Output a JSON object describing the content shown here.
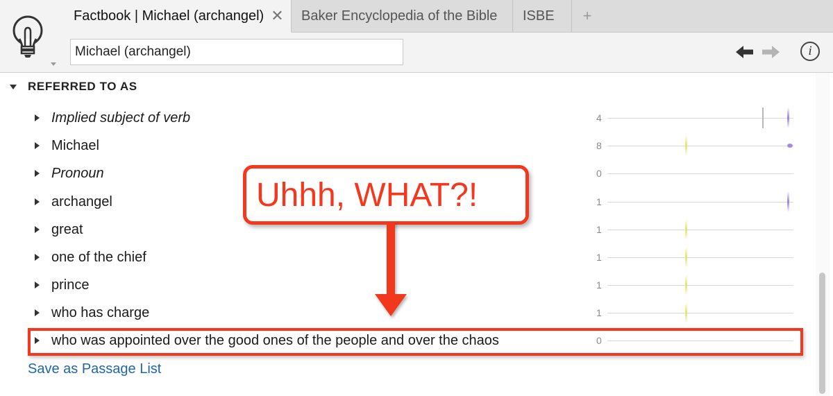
{
  "tabs": [
    {
      "label": "Factbook | Michael (archangel)",
      "active": true,
      "close_glyph": "✕"
    },
    {
      "label": "Baker Encyclopedia of the Bible",
      "active": false
    },
    {
      "label": "ISBE",
      "active": false
    }
  ],
  "add_tab_glyph": "+",
  "search": {
    "value": "Michael (archangel)"
  },
  "icons": {
    "app": "lightbulb-icon",
    "back": "arrow-left-icon",
    "forward": "arrow-right-icon",
    "info": "info-icon",
    "close": "close-icon",
    "add": "plus-icon"
  },
  "info_glyph": "i",
  "section": {
    "title": "REFERRED TO AS"
  },
  "rows": [
    {
      "label": "Implied subject of verb",
      "italic": true,
      "count": "4"
    },
    {
      "label": "Michael",
      "italic": false,
      "count": "8"
    },
    {
      "label": "Pronoun",
      "italic": true,
      "count": "0"
    },
    {
      "label": "archangel",
      "italic": false,
      "count": "1"
    },
    {
      "label": "great",
      "italic": false,
      "count": "1"
    },
    {
      "label": "one of the chief",
      "italic": false,
      "count": "1"
    },
    {
      "label": "prince",
      "italic": false,
      "count": "1"
    },
    {
      "label": "who has charge",
      "italic": false,
      "count": "1"
    },
    {
      "label": "who was appointed over the good ones of the people and over the chaos",
      "italic": false,
      "count": "0"
    }
  ],
  "save_link": "Save as Passage List",
  "annotation": {
    "callout_text": "Uhhh, WHAT?!"
  },
  "colors": {
    "annotation_red": "#f2391f",
    "link_blue": "#1f66a8",
    "mark_yellow": "#e4e26a",
    "mark_purple": "#9d80d6"
  }
}
